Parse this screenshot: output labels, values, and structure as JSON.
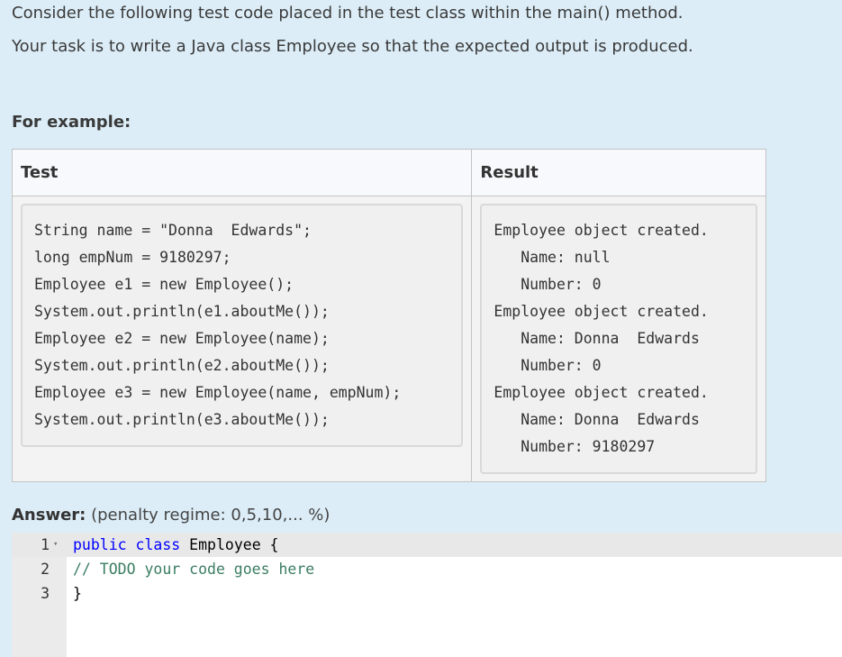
{
  "question": {
    "line1": "Consider the following test code placed in the test class within the main() method.",
    "line2": "Your task is to write a Java class Employee so that the expected output is produced."
  },
  "example": {
    "heading": "For example:",
    "col_test": "Test",
    "col_result": "Result",
    "test_code": "String name = \"Donna  Edwards\";\nlong empNum = 9180297;\nEmployee e1 = new Employee();\nSystem.out.println(e1.aboutMe());\nEmployee e2 = new Employee(name);\nSystem.out.println(e2.aboutMe());\nEmployee e3 = new Employee(name, empNum);\nSystem.out.println(e3.aboutMe());",
    "result_text": "Employee object created.\n   Name: null\n   Number: 0\nEmployee object created.\n   Name: Donna  Edwards\n   Number: 0\nEmployee object created.\n   Name: Donna  Edwards\n   Number: 9180297"
  },
  "answer": {
    "label": "Answer:",
    "penalty": "(penalty regime: 0,5,10,... %)"
  },
  "editor": {
    "lines": [
      {
        "num": "1",
        "kw": "public class",
        "text": " Employee {"
      },
      {
        "num": "2",
        "comment": "// TODO your code goes here"
      },
      {
        "num": "3",
        "text": "}"
      }
    ],
    "fold_icon": "▾"
  }
}
